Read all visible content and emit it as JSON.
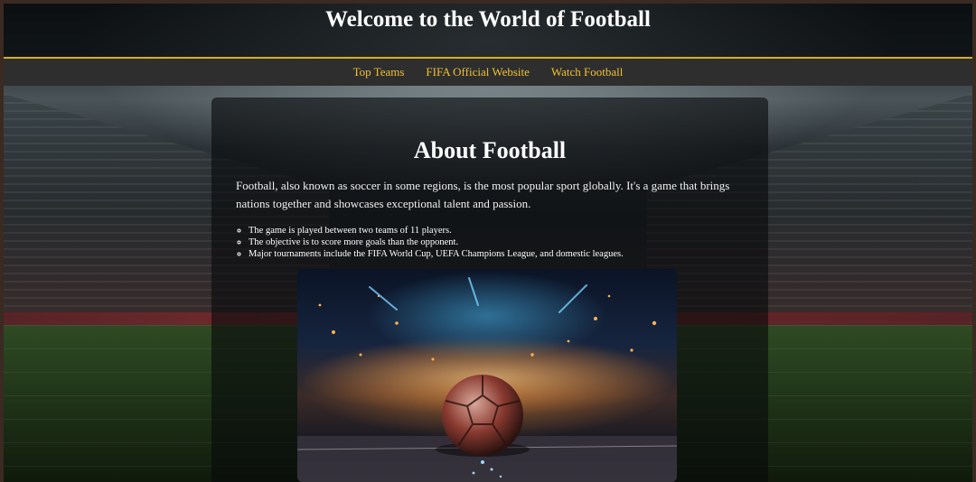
{
  "header": {
    "title": "Welcome to the World of Football"
  },
  "nav": {
    "items": [
      {
        "label": "Top Teams"
      },
      {
        "label": "FIFA Official Website"
      },
      {
        "label": "Watch Football"
      }
    ]
  },
  "main": {
    "heading": "About Football",
    "intro": "Football, also known as soccer in some regions, is the most popular sport globally. It's a game that brings nations together and showcases exceptional talent and passion.",
    "facts": [
      "The game is played between two teams of 11 players.",
      "The objective is to score more goals than the opponent.",
      "Major tournaments include the FIFA World Cup, UEFA Champions League, and domestic leagues."
    ]
  },
  "colors": {
    "accent": "#f2c12e",
    "nav_bg": "#2e2e2e",
    "divider": "#d4b11e"
  }
}
